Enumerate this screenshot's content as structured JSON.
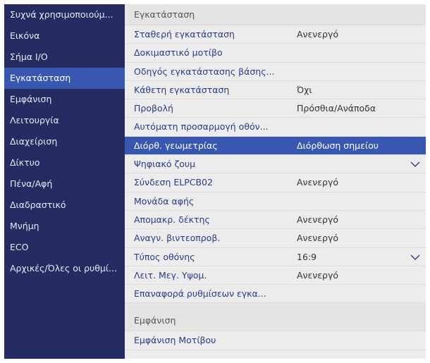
{
  "sidebar": {
    "items": [
      {
        "label": "Συχνά χρησιμοποιούμ..."
      },
      {
        "label": "Εικόνα"
      },
      {
        "label": "Σήμα I/O"
      },
      {
        "label": "Εγκατάσταση"
      },
      {
        "label": "Εμφάνιση"
      },
      {
        "label": "Λειτουργία"
      },
      {
        "label": "Διαχείριση"
      },
      {
        "label": "Δίκτυο"
      },
      {
        "label": "Πένα/Αφή"
      },
      {
        "label": "Διαδραστικό"
      },
      {
        "label": "Μνήμη"
      },
      {
        "label": "ECO"
      },
      {
        "label": "Αρχικές/Όλες οι ρυθμί..."
      }
    ],
    "active_index": 3
  },
  "main": {
    "section_title": "Εγκατάσταση",
    "rows": [
      {
        "label": "Σταθερή εγκατάσταση",
        "value": "Ανενεργό"
      },
      {
        "label": "Δοκιμαστικό μοτίβο",
        "value": ""
      },
      {
        "label": "Οδηγός εγκατάστασης βάσης...",
        "value": ""
      },
      {
        "label": "Κάθετη εγκατάσταση",
        "value": "Όχι"
      },
      {
        "label": "Προβολή",
        "value": "Πρόσθια/Ανάποδα"
      },
      {
        "label": "Αυτόματη προσαρμογή οθόν...",
        "value": ""
      },
      {
        "label": "Διόρθ. γεωμετρίας",
        "value": "Διόρθωση σημείου"
      },
      {
        "label": "Ψηφιακό ζουμ",
        "value": ""
      },
      {
        "label": "Σύνδεση ELPCB02",
        "value": "Ανενεργό"
      },
      {
        "label": "Μονάδα αφής",
        "value": ""
      },
      {
        "label": "Απομακρ. δέκτης",
        "value": "Ανενεργό"
      },
      {
        "label": "Αναγν. βιντεοπροβ.",
        "value": "Ανενεργό"
      },
      {
        "label": "Τύπος οθόνης",
        "value": "16:9"
      },
      {
        "label": "Λειτ. Μεγ. Υψομ.",
        "value": "Ανενεργό"
      },
      {
        "label": "Επαναφορά ρυθμίσεων εγκα...",
        "value": ""
      }
    ],
    "selected_index": 6,
    "next_section_title": "Εμφάνιση",
    "next_rows": [
      {
        "label": "Εμφάνιση Μοτίβου"
      }
    ],
    "chevron_icon": "chevron-down-icon"
  },
  "colors": {
    "sidebar_bg": "#242c62",
    "active_bg": "#3757b1",
    "text_accent": "#2b3a8a",
    "main_bg": "#ececec"
  }
}
